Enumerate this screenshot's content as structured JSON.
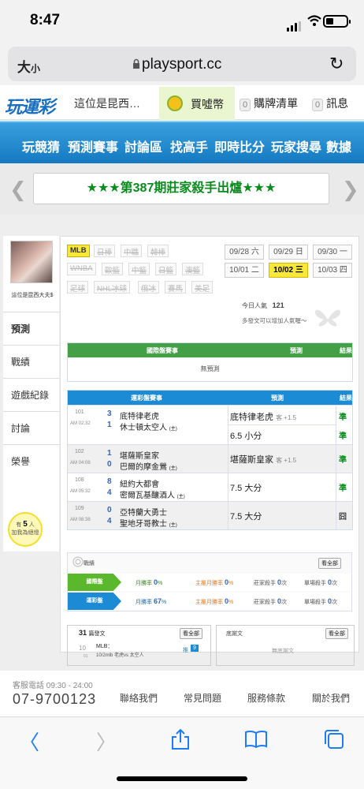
{
  "status": {
    "time": "8:47"
  },
  "browser": {
    "text_size": "大",
    "text_size_small": "小",
    "url": "playsport.cc",
    "reload": "↻"
  },
  "site": {
    "logo": "玩運彩",
    "breadcrumb": "這位是昆西…",
    "buy": "買噓幣",
    "cart_count": "0",
    "cart": "購牌清單",
    "msg_count": "0",
    "msg": "訊息"
  },
  "nav": [
    "玩競猜",
    "預測賽事",
    "討論區",
    "找高手",
    "即時比分",
    "玩家搜尋",
    "數據"
  ],
  "banner": "★★★第387期莊家殺手出爐★★★",
  "user": {
    "name": "這位是昆西大夫$",
    "tabs": [
      "預測",
      "戰績",
      "遊戲紀錄",
      "討論",
      "榮譽"
    ],
    "fans_pre": "有",
    "fans": "5",
    "fans_post": "人",
    "fans_line2": "加我為絕燈"
  },
  "sports": [
    "MLB",
    "日棒",
    "中職",
    "韓棒",
    "WNBA",
    "歐籃",
    "中籃",
    "日籃",
    "澳籃",
    "足球",
    "NHL冰球",
    "俄冰",
    "賽馬",
    "美足"
  ],
  "dates": [
    "09/28 六",
    "09/29 日",
    "09/30 一",
    "10/01 二",
    "10/02 三",
    "10/03 四"
  ],
  "popularity": {
    "label": "今日人氣",
    "value": "121",
    "tip": "多發文可以增加人氣喔～"
  },
  "intl": {
    "h1": "國際盤賽事",
    "h2": "預測",
    "h3": "結果",
    "empty": "無預測"
  },
  "lottery": {
    "h1": "運彩盤賽事",
    "h2": "預測",
    "h3": "結果",
    "games": [
      {
        "no": "101",
        "time": "AM 02:32",
        "s1": "3",
        "t1": "底特律老虎",
        "s2": "1",
        "t2": "休士頓太空人",
        "t2n": "(主)",
        "picks": [
          {
            "text": "底特律老虎",
            "extra": "客 +1.5"
          },
          {
            "text": "6.5 小分",
            "extra": ""
          }
        ],
        "results": [
          "準",
          "準"
        ]
      },
      {
        "no": "102",
        "time": "AM 04:08",
        "s1": "1",
        "t1": "堪薩斯皇家",
        "s2": "0",
        "t2": "巴爾的摩金鶯",
        "t2n": "(主)",
        "picks": [
          {
            "text": "堪薩斯皇家",
            "extra": "客 +1.5"
          }
        ],
        "results": [
          "準"
        ]
      },
      {
        "no": "108",
        "time": "AM 05:32",
        "s1": "8",
        "t1": "紐約大都會",
        "s2": "4",
        "t2": "密爾瓦基釀酒人",
        "t2n": "(主)",
        "picks": [
          {
            "text": "7.5 大分",
            "extra": ""
          }
        ],
        "results": [
          "準"
        ]
      },
      {
        "no": "109",
        "time": "AM 08:38",
        "s1": "0",
        "t1": "亞特蘭大勇士",
        "s2": "4",
        "t2": "聖地牙哥教士",
        "t2n": "(主)",
        "picks": [
          {
            "text": "7.5 大分",
            "extra": ""
          }
        ],
        "results": [
          "囧"
        ]
      }
    ]
  },
  "stats": {
    "title": "戰績",
    "all": "看全部",
    "rows": [
      {
        "tag": "國際盤",
        "c1l": "月勝率",
        "c1v": "0",
        "c2l": "主推月勝率",
        "c2v": "0",
        "c3l": "莊家殺手",
        "c3v": "0",
        "c4l": "單場殺手",
        "c4v": "0"
      },
      {
        "tag": "運彩盤",
        "c1l": "月勝率",
        "c1v": "67",
        "c2l": "主推月勝率",
        "c2v": "0",
        "c3l": "莊家殺手",
        "c3v": "0",
        "c4l": "單場殺手",
        "c4v": "0"
      }
    ],
    "pct": "%",
    "times": "次"
  },
  "posts": {
    "count": "31",
    "label": "篇發文",
    "all": "看全部",
    "item": {
      "m": "10",
      "d": "01",
      "title": "MLB：",
      "sub": "10/2mlb 老虎vs 太空人",
      "tag": "推",
      "num": "9"
    }
  },
  "summary": {
    "title": "底謝文",
    "all": "看全部",
    "empty": "無底謝文"
  },
  "footer": {
    "tel_label": "客服電話 09:30 - 24:00",
    "tel": "07-9700123",
    "links": [
      "聯絡我們",
      "常見問題",
      "服務條款",
      "關於我們"
    ]
  },
  "safari": {
    "back": "〈",
    "fwd": "〉"
  },
  "colors": {
    "nav": "#1579c1",
    "green": "#0a8c1d",
    "highlight": "#f7e83a"
  }
}
